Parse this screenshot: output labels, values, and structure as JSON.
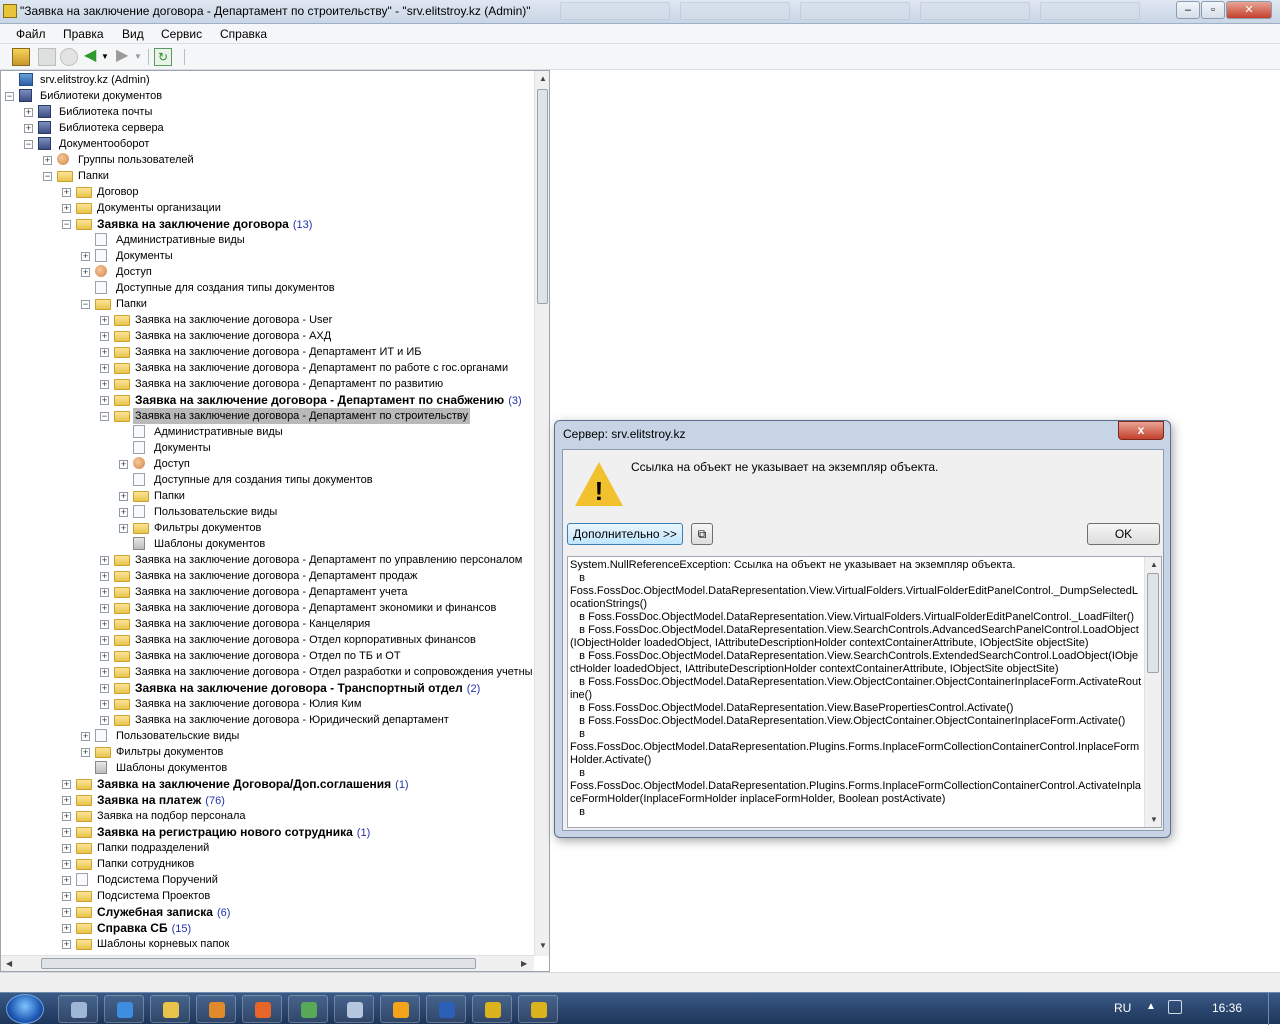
{
  "window": {
    "title": "\"Заявка на заключение договора - Департамент по строительству\" - \"srv.elitstroy.kz (Admin)\""
  },
  "menu": [
    "Файл",
    "Правка",
    "Вид",
    "Сервис",
    "Справка"
  ],
  "tree": [
    {
      "label": "srv.elitstroy.kz (Admin)",
      "count": "",
      "level": 0,
      "bold": false,
      "expander": "none",
      "icon": "root-server-icon"
    },
    {
      "label": "Библиотеки документов",
      "count": "",
      "level": 0,
      "bold": false,
      "expander": "minus",
      "icon": "database-icon"
    },
    {
      "label": "Библиотека почты",
      "count": "",
      "level": 1,
      "bold": false,
      "expander": "plus",
      "icon": "database-icon"
    },
    {
      "label": "Библиотека сервера",
      "count": "",
      "level": 1,
      "bold": false,
      "expander": "plus",
      "icon": "database-icon"
    },
    {
      "label": "Документооборот",
      "count": "",
      "level": 1,
      "bold": false,
      "expander": "minus",
      "icon": "database-icon"
    },
    {
      "label": "Группы пользователей",
      "count": "",
      "level": 2,
      "bold": false,
      "expander": "plus",
      "icon": "users-icon"
    },
    {
      "label": "Папки",
      "count": "",
      "level": 2,
      "bold": false,
      "expander": "minus",
      "icon": "folder-icon"
    },
    {
      "label": "Договор",
      "count": "",
      "level": 3,
      "bold": false,
      "expander": "plus",
      "icon": "folder-icon"
    },
    {
      "label": "Документы организации",
      "count": "",
      "level": 3,
      "bold": false,
      "expander": "plus",
      "icon": "folder-icon"
    },
    {
      "label": "Заявка на заключение договора",
      "count": "(13)",
      "level": 3,
      "bold": true,
      "expander": "minus",
      "icon": "folder-icon"
    },
    {
      "label": "Административные виды",
      "count": "",
      "level": 4,
      "bold": false,
      "expander": "none",
      "icon": "view-icon"
    },
    {
      "label": "Документы",
      "count": "",
      "level": 4,
      "bold": false,
      "expander": "plus",
      "icon": "document-icon"
    },
    {
      "label": "Доступ",
      "count": "",
      "level": 4,
      "bold": false,
      "expander": "plus",
      "icon": "user-icon"
    },
    {
      "label": "Доступные для создания типы документов",
      "count": "",
      "level": 4,
      "bold": false,
      "expander": "none",
      "icon": "doc-types-icon"
    },
    {
      "label": "Папки",
      "count": "",
      "level": 4,
      "bold": false,
      "expander": "minus",
      "icon": "folder-icon"
    },
    {
      "label": "Заявка на заключение договора - User",
      "count": "",
      "level": 5,
      "bold": false,
      "expander": "plus",
      "icon": "folder-icon"
    },
    {
      "label": "Заявка на заключение договора - АХД",
      "count": "",
      "level": 5,
      "bold": false,
      "expander": "plus",
      "icon": "folder-icon"
    },
    {
      "label": "Заявка на заключение договора - Департамент ИТ и ИБ",
      "count": "",
      "level": 5,
      "bold": false,
      "expander": "plus",
      "icon": "folder-icon"
    },
    {
      "label": "Заявка на заключение договора - Департамент по работе с гос.органами",
      "count": "",
      "level": 5,
      "bold": false,
      "expander": "plus",
      "icon": "folder-icon"
    },
    {
      "label": "Заявка на заключение договора - Департамент по развитию",
      "count": "",
      "level": 5,
      "bold": false,
      "expander": "plus",
      "icon": "folder-icon"
    },
    {
      "label": "Заявка на заключение договора - Департамент по снабжению",
      "count": "(3)",
      "level": 5,
      "bold": true,
      "expander": "plus",
      "icon": "folder-icon"
    },
    {
      "label": "Заявка на заключение договора - Департамент по строительству",
      "count": "",
      "level": 5,
      "bold": false,
      "expander": "minus",
      "icon": "folder-open-icon",
      "selected": true
    },
    {
      "label": "Административные виды",
      "count": "",
      "level": 6,
      "bold": false,
      "expander": "none",
      "icon": "view-icon"
    },
    {
      "label": "Документы",
      "count": "",
      "level": 6,
      "bold": false,
      "expander": "none",
      "icon": "document-icon"
    },
    {
      "label": "Доступ",
      "count": "",
      "level": 6,
      "bold": false,
      "expander": "plus",
      "icon": "user-icon"
    },
    {
      "label": "Доступные для создания типы документов",
      "count": "",
      "level": 6,
      "bold": false,
      "expander": "none",
      "icon": "doc-types-icon"
    },
    {
      "label": "Папки",
      "count": "",
      "level": 6,
      "bold": false,
      "expander": "plus",
      "icon": "folder-icon"
    },
    {
      "label": "Пользовательские виды",
      "count": "",
      "level": 6,
      "bold": false,
      "expander": "plus",
      "icon": "view-icon"
    },
    {
      "label": "Фильтры документов",
      "count": "",
      "level": 6,
      "bold": false,
      "expander": "plus",
      "icon": "filter-icon"
    },
    {
      "label": "Шаблоны документов",
      "count": "",
      "level": 6,
      "bold": false,
      "expander": "none",
      "icon": "template-icon"
    },
    {
      "label": "Заявка на заключение договора - Департамент по управлению персоналом",
      "count": "",
      "level": 5,
      "bold": false,
      "expander": "plus",
      "icon": "folder-icon"
    },
    {
      "label": "Заявка на заключение договора - Департамент продаж",
      "count": "",
      "level": 5,
      "bold": false,
      "expander": "plus",
      "icon": "folder-icon"
    },
    {
      "label": "Заявка на заключение договора - Департамент учета",
      "count": "",
      "level": 5,
      "bold": false,
      "expander": "plus",
      "icon": "folder-icon"
    },
    {
      "label": "Заявка на заключение договора - Департамент экономики и финансов",
      "count": "",
      "level": 5,
      "bold": false,
      "expander": "plus",
      "icon": "folder-icon"
    },
    {
      "label": "Заявка на заключение договора - Канцелярия",
      "count": "",
      "level": 5,
      "bold": false,
      "expander": "plus",
      "icon": "folder-icon"
    },
    {
      "label": "Заявка на заключение договора - Отдел корпоративных финансов",
      "count": "",
      "level": 5,
      "bold": false,
      "expander": "plus",
      "icon": "folder-icon"
    },
    {
      "label": "Заявка на заключение договора - Отдел по ТБ и ОТ",
      "count": "",
      "level": 5,
      "bold": false,
      "expander": "plus",
      "icon": "folder-icon"
    },
    {
      "label": "Заявка на заключение договора - Отдел разработки и сопровождения учетны",
      "count": "",
      "level": 5,
      "bold": false,
      "expander": "plus",
      "icon": "folder-icon"
    },
    {
      "label": "Заявка на заключение договора - Транспортный отдел",
      "count": "(2)",
      "level": 5,
      "bold": true,
      "expander": "plus",
      "icon": "folder-icon"
    },
    {
      "label": "Заявка на заключение договора - Юлия Ким",
      "count": "",
      "level": 5,
      "bold": false,
      "expander": "plus",
      "icon": "folder-icon"
    },
    {
      "label": "Заявка на заключение договора - Юридический департамент",
      "count": "",
      "level": 5,
      "bold": false,
      "expander": "plus",
      "icon": "folder-icon"
    },
    {
      "label": "Пользовательские виды",
      "count": "",
      "level": 4,
      "bold": false,
      "expander": "plus",
      "icon": "view-icon"
    },
    {
      "label": "Фильтры документов",
      "count": "",
      "level": 4,
      "bold": false,
      "expander": "plus",
      "icon": "filter-icon"
    },
    {
      "label": "Шаблоны документов",
      "count": "",
      "level": 4,
      "bold": false,
      "expander": "none",
      "icon": "template-icon"
    },
    {
      "label": "Заявка на заключение Договора/Доп.соглашения",
      "count": "(1)",
      "level": 3,
      "bold": true,
      "expander": "plus",
      "icon": "folder-icon"
    },
    {
      "label": "Заявка на платеж",
      "count": "(76)",
      "level": 3,
      "bold": true,
      "expander": "plus",
      "icon": "folder-icon"
    },
    {
      "label": "Заявка на подбор персонала",
      "count": "",
      "level": 3,
      "bold": false,
      "expander": "plus",
      "icon": "folder-icon"
    },
    {
      "label": "Заявка на регистрацию нового сотрудника",
      "count": "(1)",
      "level": 3,
      "bold": true,
      "expander": "plus",
      "icon": "folder-icon"
    },
    {
      "label": "Папки подразделений",
      "count": "",
      "level": 3,
      "bold": false,
      "expander": "plus",
      "icon": "folder-icon"
    },
    {
      "label": "Папки сотрудников",
      "count": "",
      "level": 3,
      "bold": false,
      "expander": "plus",
      "icon": "folder-icon"
    },
    {
      "label": "Подсистема Поручений",
      "count": "",
      "level": 3,
      "bold": false,
      "expander": "plus",
      "icon": "tasks-icon"
    },
    {
      "label": "Подсистема Проектов",
      "count": "",
      "level": 3,
      "bold": false,
      "expander": "plus",
      "icon": "folder-icon"
    },
    {
      "label": "Служебная записка",
      "count": "(6)",
      "level": 3,
      "bold": true,
      "expander": "plus",
      "icon": "folder-icon"
    },
    {
      "label": "Справка СБ",
      "count": "(15)",
      "level": 3,
      "bold": true,
      "expander": "plus",
      "icon": "folder-icon"
    },
    {
      "label": "Шаблоны корневых папок",
      "count": "",
      "level": 3,
      "bold": false,
      "expander": "plus",
      "icon": "folder-icon"
    }
  ],
  "dialog": {
    "title": "Сервер: srv.elitstroy.kz",
    "close_label": "x",
    "message": "Ссылка на объект не указывает на экземпляр объекта.",
    "details_button": "Дополнительно >>",
    "ok_button": "OK",
    "stack_trace": "System.NullReferenceException: Ссылка на объект не указывает на экземпляр объекта.\n   в\nFoss.FossDoc.ObjectModel.DataRepresentation.View.VirtualFolders.VirtualFolderEditPanelControl._DumpSelectedLocationStrings()\n   в Foss.FossDoc.ObjectModel.DataRepresentation.View.VirtualFolders.VirtualFolderEditPanelControl._LoadFilter()\n   в Foss.FossDoc.ObjectModel.DataRepresentation.View.SearchControls.AdvancedSearchPanelControl.LoadObject(IObjectHolder loadedObject, IAttributeDescriptionHolder contextContainerAttribute, IObjectSite objectSite)\n   в Foss.FossDoc.ObjectModel.DataRepresentation.View.SearchControls.ExtendedSearchControl.LoadObject(IObjectHolder loadedObject, IAttributeDescriptionHolder contextContainerAttribute, IObjectSite objectSite)\n   в Foss.FossDoc.ObjectModel.DataRepresentation.View.ObjectContainer.ObjectContainerInplaceForm.ActivateRoutine()\n   в Foss.FossDoc.ObjectModel.DataRepresentation.View.BasePropertiesControl.Activate()\n   в Foss.FossDoc.ObjectModel.DataRepresentation.View.ObjectContainer.ObjectContainerInplaceForm.Activate()\n   в\nFoss.FossDoc.ObjectModel.DataRepresentation.Plugins.Forms.InplaceFormCollectionContainerControl.InplaceFormHolder.Activate()\n   в\nFoss.FossDoc.ObjectModel.DataRepresentation.Plugins.Forms.InplaceFormCollectionContainerControl.ActivateInplaceFormHolder(InplaceFormHolder inplaceFormHolder, Boolean postActivate)\n   в"
  },
  "taskbar": {
    "apps": [
      "explorer-window-icon",
      "internet-explorer-icon",
      "file-explorer-icon",
      "media-player-icon",
      "firefox-icon",
      "chrome-icon",
      "network-icon",
      "outlook-icon",
      "word-icon",
      "fossdoc-icon",
      "fossdoc-icon-2"
    ],
    "language": "RU",
    "time": "16:36"
  },
  "colors": {
    "selection": "#b9b9b9",
    "count": "#2233aa",
    "taskbar": "#1d355a",
    "dialog_frame": "#c6d4e6"
  }
}
